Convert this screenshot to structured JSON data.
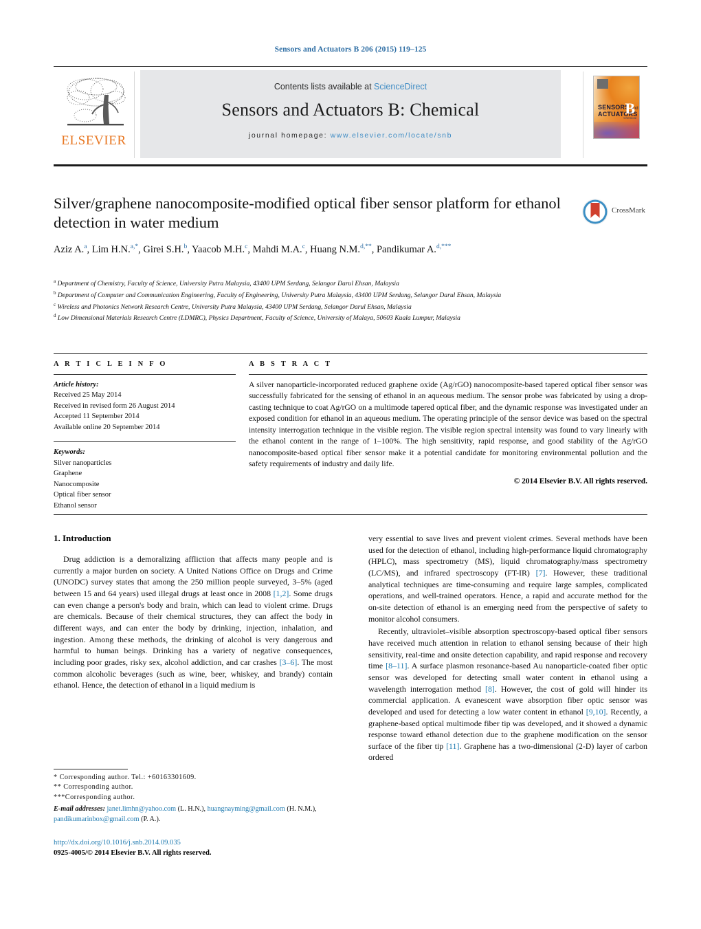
{
  "running_head": "Sensors and Actuators B 206 (2015) 119–125",
  "masthead": {
    "contents_prefix": "Contents lists available at ",
    "sciencedirect": "ScienceDirect",
    "journal_title": "Sensors and Actuators B: Chemical",
    "homepage_prefix": "journal homepage: ",
    "homepage_url": "www.elsevier.com/locate/snb",
    "publisher_wordmark": "ELSEVIER",
    "cover": {
      "line1": "SENSORS",
      "and": "and",
      "line2": "ACTUATORS",
      "letter": "B",
      "sub": "Chemical"
    }
  },
  "article": {
    "title": "Silver/graphene nanocomposite-modified optical fiber sensor platform for ethanol detection in water medium",
    "crossmark_label": "CrossMark",
    "authors": [
      {
        "name": "Aziz A.",
        "marks": "a",
        "sep": ", "
      },
      {
        "name": "Lim H.N.",
        "marks": "a,*",
        "sep": ", "
      },
      {
        "name": "Girei S.H.",
        "marks": "b",
        "sep": ", "
      },
      {
        "name": "Yaacob M.H.",
        "marks": "c",
        "sep": ", "
      },
      {
        "name": "Mahdi M.A.",
        "marks": "c",
        "sep": ", "
      },
      {
        "name": "Huang N.M.",
        "marks": "d,**",
        "sep": ", "
      },
      {
        "name": "Pandikumar A.",
        "marks": "d,***",
        "sep": ""
      }
    ],
    "affiliations": [
      {
        "mark": "a",
        "text": "Department of Chemistry, Faculty of Science, University Putra Malaysia, 43400 UPM Serdang, Selangor Darul Ehsan, Malaysia"
      },
      {
        "mark": "b",
        "text": "Department of Computer and Communication Engineering, Faculty of Engineering, University Putra Malaysia, 43400 UPM Serdang, Selangor Darul Ehsan, Malaysia"
      },
      {
        "mark": "c",
        "text": "Wireless and Photonics Network Research Centre, University Putra Malaysia, 43400 UPM Serdang, Selangor Darul Ehsan, Malaysia"
      },
      {
        "mark": "d",
        "text": "Low Dimensional Materials Research Centre (LDMRC), Physics Department, Faculty of Science, University of Malaya, 50603 Kuala Lumpur, Malaysia"
      }
    ]
  },
  "article_info": {
    "heading": "A R T I C L E   I N F O",
    "history_label": "Article history:",
    "history": [
      "Received 25 May 2014",
      "Received in revised form 26 August 2014",
      "Accepted 11 September 2014",
      "Available online 20 September 2014"
    ],
    "keywords_label": "Keywords:",
    "keywords": [
      "Silver nanoparticles",
      "Graphene",
      "Nanocomposite",
      "Optical fiber sensor",
      "Ethanol sensor"
    ]
  },
  "abstract": {
    "heading": "A B S T R A C T",
    "text": "A silver nanoparticle-incorporated reduced graphene oxide (Ag/rGO) nanocomposite-based tapered optical fiber sensor was successfully fabricated for the sensing of ethanol in an aqueous medium. The sensor probe was fabricated by using a drop-casting technique to coat Ag/rGO on a multimode tapered optical fiber, and the dynamic response was investigated under an exposed condition for ethanol in an aqueous medium. The operating principle of the sensor device was based on the spectral intensity interrogation technique in the visible region. The visible region spectral intensity was found to vary linearly with the ethanol content in the range of 1–100%. The high sensitivity, rapid response, and good stability of the Ag/rGO nanocomposite-based optical fiber sensor make it a potential candidate for monitoring environmental pollution and the safety requirements of industry and daily life.",
    "copyright": "© 2014 Elsevier B.V. All rights reserved."
  },
  "body": {
    "section_heading": "1.  Introduction",
    "left": [
      {
        "t1": "Drug addiction is a demoralizing affliction that affects many people and is currently a major burden on society. A United Nations Office on Drugs and Crime (UNODC) survey states that among the 250 million people surveyed, 3–5% (aged between 15 and 64 years) used illegal drugs at least once in 2008 ",
        "ref1": "[1,2]",
        "t2": ". Some drugs can even change a person's body and brain, which can lead to violent crime. Drugs are chemicals. Because of their chemical structures, they can affect the body in different ways, and can enter the body by drinking, injection, inhalation, and ingestion. Among these methods, the drinking of alcohol is very dangerous and harmful to human beings. Drinking has a variety of negative consequences, including poor grades, risky sex, alcohol addiction, and car crashes ",
        "ref2": "[3–6]",
        "t3": ". The most common alcoholic beverages (such as wine, beer, whiskey, and brandy) contain ethanol. Hence, the detection of ethanol in a liquid medium is"
      }
    ],
    "right": [
      {
        "t1": "very essential to save lives and prevent violent crimes. Several methods have been used for the detection of ethanol, including high-performance liquid chromatography (HPLC), mass spectrometry (MS), liquid chromatography/mass spectrometry (LC/MS), and infrared spectroscopy (FT-IR) ",
        "ref1": "[7]",
        "t2": ". However, these traditional analytical techniques are time-consuming and require large samples, complicated operations, and well-trained operators. Hence, a rapid and accurate method for the on-site detection of ethanol is an emerging need from the perspective of safety to monitor alcohol consumers."
      },
      {
        "t1": "Recently, ultraviolet–visible absorption spectroscopy-based optical fiber sensors have received much attention in relation to ethanol sensing because of their high sensitivity, real-time and onsite detection capability, and rapid response and recovery time ",
        "ref1": "[8–11]",
        "t2": ". A surface plasmon resonance-based Au nanoparticle-coated fiber optic sensor was developed for detecting small water content in ethanol using a wavelength interrogation method ",
        "ref2": "[8]",
        "t3": ". However, the cost of gold will hinder its commercial application. A evanescent wave absorption fiber optic sensor was developed and used for detecting a low water content in ethanol ",
        "ref3": "[9,10]",
        "t4": ". Recently, a graphene-based optical multimode fiber tip was developed, and it showed a dynamic response toward ethanol detection due to the graphene modification on the sensor surface of the fiber tip ",
        "ref4": "[11]",
        "t5": ". Graphene has a two-dimensional (2-D) layer of carbon ordered"
      }
    ]
  },
  "footnotes": {
    "line1": "*  Corresponding author. Tel.: +60163301609.",
    "line2": "**  Corresponding author.",
    "line3": "***Corresponding author.",
    "email_label": "E-mail addresses:",
    "emails": [
      {
        "address": "janet.limhn@yahoo.com",
        "attrib": " (L. H.N.), "
      },
      {
        "address": "huangnayming@gmail.com",
        "attrib": " (H. N.M.), "
      },
      {
        "address": "pandikumarinbox@gmail.com",
        "attrib": " (P. A.)."
      }
    ]
  },
  "doi_block": {
    "doi": "http://dx.doi.org/10.1016/j.snb.2014.09.035",
    "issn": "0925-4005/© 2014 Elsevier B.V. All rights reserved."
  },
  "colors": {
    "link": "#1f7ab0",
    "running_head": "#2b6ca3",
    "elsevier_orange": "#e87722",
    "masthead_bg": "#e6e7e9"
  }
}
